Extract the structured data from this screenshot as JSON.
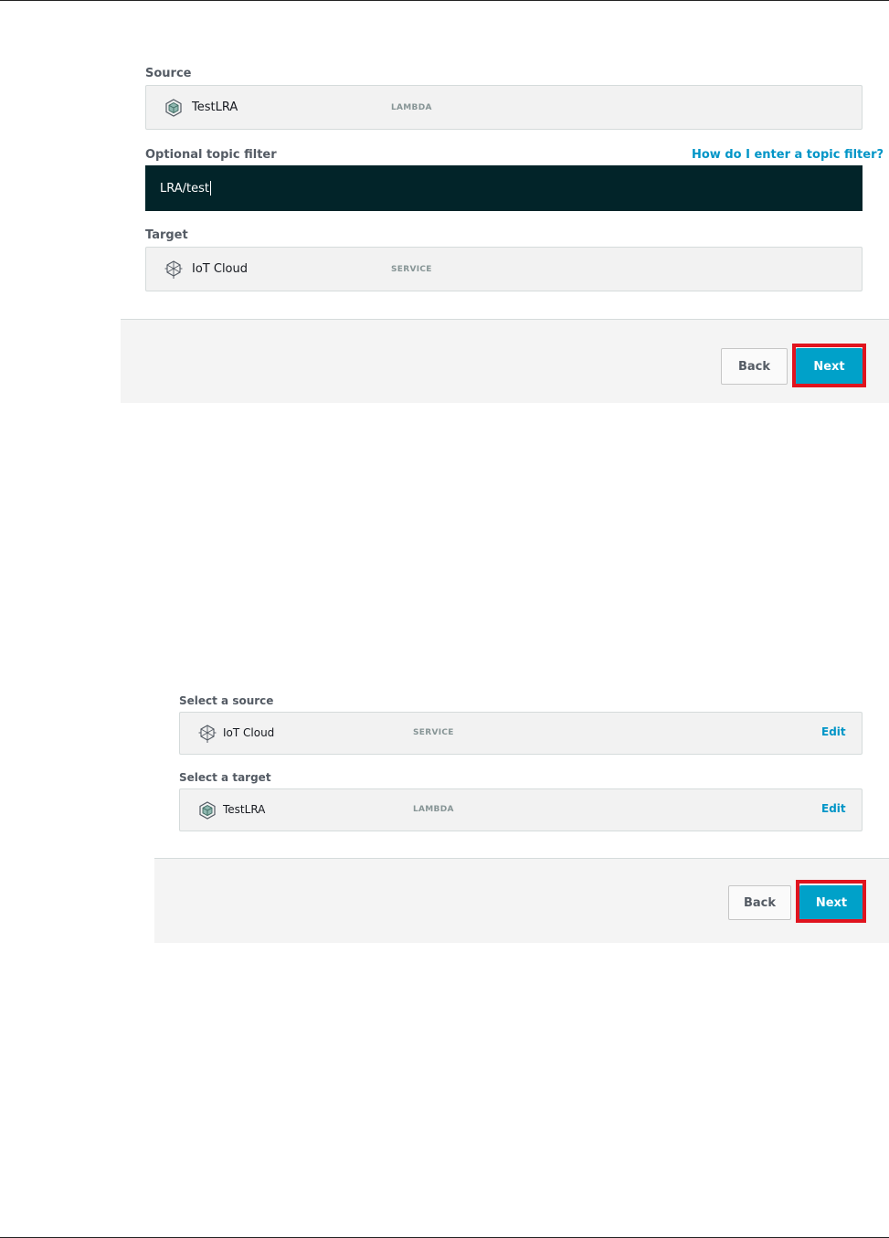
{
  "panel_1": {
    "source_label": "Source",
    "source": {
      "name": "TestLRA",
      "type": "LAMBDA",
      "icon": "lambda-cube-icon"
    },
    "topic_filter_label": "Optional topic filter",
    "topic_filter_help": "How do I enter a topic filter?",
    "topic_filter_value": "LRA/test",
    "target_label": "Target",
    "target": {
      "name": "IoT Cloud",
      "type": "SERVICE",
      "icon": "iot-cloud-icon"
    },
    "back_label": "Back",
    "next_label": "Next"
  },
  "panel_2": {
    "source_label": "Select a source",
    "source": {
      "name": "IoT Cloud",
      "type": "SERVICE",
      "icon": "iot-cloud-icon",
      "edit_label": "Edit"
    },
    "target_label": "Select a target",
    "target": {
      "name": "TestLRA",
      "type": "LAMBDA",
      "icon": "lambda-cube-icon",
      "edit_label": "Edit"
    },
    "back_label": "Back",
    "next_label": "Next"
  },
  "colors": {
    "accent": "#00a1c9",
    "link": "#0095c7",
    "input_bg": "#022429",
    "highlight": "#e0141e"
  }
}
